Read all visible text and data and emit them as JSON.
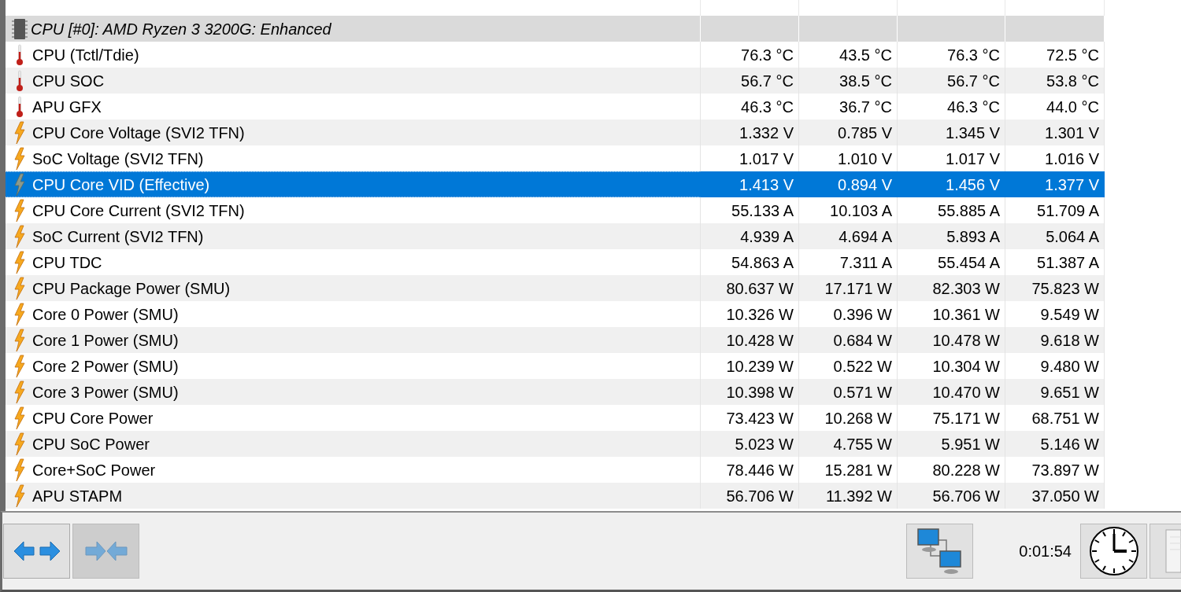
{
  "group": {
    "label": "CPU [#0]: AMD Ryzen 3 3200G: Enhanced",
    "expanded": true
  },
  "rows": [
    {
      "kind": "temperature",
      "label": "CPU (Tctl/Tdie)",
      "values": [
        "76.3 °C",
        "43.5 °C",
        "76.3 °C",
        "72.5 °C"
      ],
      "selected": false
    },
    {
      "kind": "temperature",
      "label": "CPU SOC",
      "values": [
        "56.7 °C",
        "38.5 °C",
        "56.7 °C",
        "53.8 °C"
      ],
      "selected": false
    },
    {
      "kind": "temperature",
      "label": "APU GFX",
      "values": [
        "46.3 °C",
        "36.7 °C",
        "46.3 °C",
        "44.0 °C"
      ],
      "selected": false
    },
    {
      "kind": "electric",
      "label": "CPU Core Voltage (SVI2 TFN)",
      "values": [
        "1.332 V",
        "0.785 V",
        "1.345 V",
        "1.301 V"
      ],
      "selected": false
    },
    {
      "kind": "electric",
      "label": "SoC Voltage (SVI2 TFN)",
      "values": [
        "1.017 V",
        "1.010 V",
        "1.017 V",
        "1.016 V"
      ],
      "selected": false
    },
    {
      "kind": "electric",
      "label": "CPU Core VID (Effective)",
      "values": [
        "1.413 V",
        "0.894 V",
        "1.456 V",
        "1.377 V"
      ],
      "selected": true
    },
    {
      "kind": "electric",
      "label": "CPU Core Current (SVI2 TFN)",
      "values": [
        "55.133 A",
        "10.103 A",
        "55.885 A",
        "51.709 A"
      ],
      "selected": false
    },
    {
      "kind": "electric",
      "label": "SoC Current (SVI2 TFN)",
      "values": [
        "4.939 A",
        "4.694 A",
        "5.893 A",
        "5.064 A"
      ],
      "selected": false
    },
    {
      "kind": "electric",
      "label": "CPU TDC",
      "values": [
        "54.863 A",
        "7.311 A",
        "55.454 A",
        "51.387 A"
      ],
      "selected": false
    },
    {
      "kind": "electric",
      "label": "CPU Package Power (SMU)",
      "values": [
        "80.637 W",
        "17.171 W",
        "82.303 W",
        "75.823 W"
      ],
      "selected": false
    },
    {
      "kind": "electric",
      "label": "Core 0 Power (SMU)",
      "values": [
        "10.326 W",
        "0.396 W",
        "10.361 W",
        "9.549 W"
      ],
      "selected": false
    },
    {
      "kind": "electric",
      "label": "Core 1 Power (SMU)",
      "values": [
        "10.428 W",
        "0.684 W",
        "10.478 W",
        "9.618 W"
      ],
      "selected": false
    },
    {
      "kind": "electric",
      "label": "Core 2 Power (SMU)",
      "values": [
        "10.239 W",
        "0.522 W",
        "10.304 W",
        "9.480 W"
      ],
      "selected": false
    },
    {
      "kind": "electric",
      "label": "Core 3 Power (SMU)",
      "values": [
        "10.398 W",
        "0.571 W",
        "10.470 W",
        "9.651 W"
      ],
      "selected": false
    },
    {
      "kind": "electric",
      "label": "CPU Core Power",
      "values": [
        "73.423 W",
        "10.268 W",
        "75.171 W",
        "68.751 W"
      ],
      "selected": false
    },
    {
      "kind": "electric",
      "label": "CPU SoC Power",
      "values": [
        "5.023 W",
        "4.755 W",
        "5.951 W",
        "5.146 W"
      ],
      "selected": false
    },
    {
      "kind": "electric",
      "label": "Core+SoC Power",
      "values": [
        "78.446 W",
        "15.281 W",
        "80.228 W",
        "73.897 W"
      ],
      "selected": false
    },
    {
      "kind": "electric",
      "label": "APU STAPM",
      "values": [
        "56.706 W",
        "11.392 W",
        "56.706 W",
        "37.050 W"
      ],
      "selected": false
    }
  ],
  "toolbar": {
    "expand_button": {
      "disabled": false
    },
    "collapse_button": {
      "disabled": true
    },
    "elapsed_time": "0:01:54"
  }
}
